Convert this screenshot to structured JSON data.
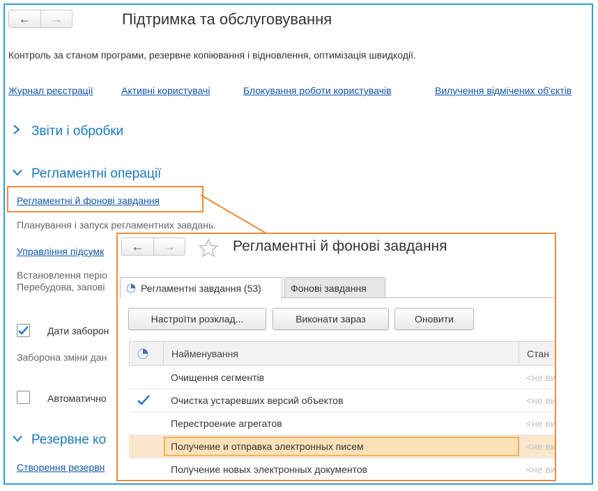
{
  "colors": {
    "accent": "#2b9ee0",
    "highlight": "#ee8a3a",
    "link": "#1155aa",
    "section": "#1a7abf",
    "selected_row": "#fbe7cc"
  },
  "main": {
    "nav": {
      "back_icon": "arrow-left-icon",
      "forward_icon": "arrow-right-icon"
    },
    "title": "Підтримка та обслуговування",
    "description": "Контроль за станом програми, резервне копіювання і відновлення, оптимізація швидкодії.",
    "links": [
      "Журнал реєстрації",
      "Активні користувачі",
      "Блокування роботи користувачів",
      "Вилучення відмічених об'єктів"
    ],
    "sections": {
      "reports": "Звіти і обробки",
      "routine": "Регламентні операції",
      "backup": "Резервне ко"
    },
    "routine": {
      "tasks_link": "Регламентні й фонові завдання",
      "tasks_desc": "Планування і запуск регламентних завдань.",
      "totals_link": "Управління підсумк",
      "totals_desc_1": "Встановлення періо",
      "totals_desc_2": "Перебудова, запові",
      "dates_checkbox_label": "Дати заборон",
      "dates_checked": true,
      "dates_desc": "Заборона зміни дан",
      "auto_checkbox_label": "Автоматично",
      "auto_checked": false
    },
    "backup_link": "Створення резервн"
  },
  "popup": {
    "title": "Регламентні й фонові завдання",
    "star_icon": "star-outline-icon",
    "tabs": [
      {
        "label": "Регламентні завдання (53)",
        "icon": "clock-icon",
        "active": true
      },
      {
        "label": "Фонові завдання",
        "active": false
      }
    ],
    "buttons": {
      "schedule": "Настроїти розклад...",
      "run_now": "Виконати зараз",
      "refresh": "Оновити"
    },
    "table": {
      "columns": {
        "name": "Найменування",
        "state": "Стан"
      },
      "rows": [
        {
          "name": "Очищення сегментів",
          "state": "<не визначено>",
          "checked": false,
          "selected": false
        },
        {
          "name": "Очистка устаревших версий объектов",
          "state": "<не визначено>",
          "checked": true,
          "selected": false
        },
        {
          "name": "Перестроение агрегатов",
          "state": "<не визначено>",
          "checked": false,
          "selected": false
        },
        {
          "name": "Получение и отправка электронных писем",
          "state": "<не визначено>",
          "checked": false,
          "selected": true
        },
        {
          "name": "Получение новых электронных документов",
          "state": "<не визначено>",
          "checked": false,
          "selected": false
        }
      ]
    }
  }
}
